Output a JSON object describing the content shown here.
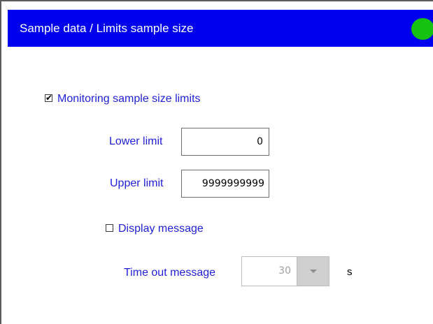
{
  "window": {
    "title": "Sample data / Limits sample size",
    "status_color": "#16c10f",
    "titlebar_color": "#0000ee"
  },
  "monitoring": {
    "checked": true,
    "check_glyph": "✔",
    "label": "Monitoring sample size limits"
  },
  "lower_limit": {
    "label": "Lower limit",
    "value": "0"
  },
  "upper_limit": {
    "label": "Upper limit",
    "value": "9999999999"
  },
  "display_message": {
    "checked": false,
    "label": "Display message"
  },
  "timeout": {
    "label": "Time out message",
    "value": "30",
    "unit": "s",
    "enabled": false,
    "dropdown_icon": "chevron-down-icon"
  },
  "colors": {
    "label_text": "#1f1fd6"
  }
}
